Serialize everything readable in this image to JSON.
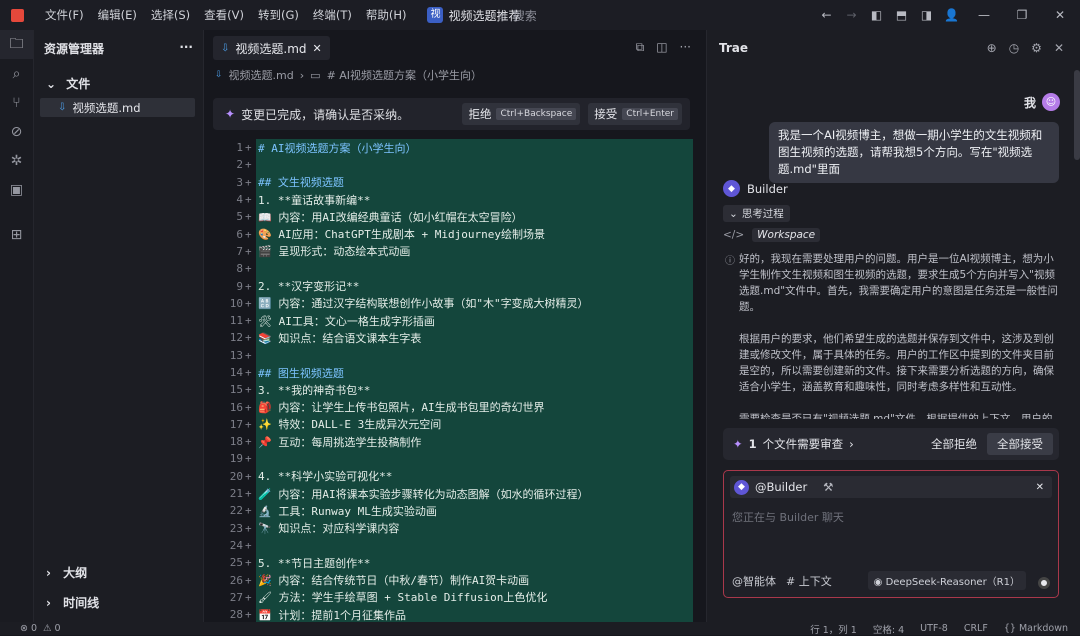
{
  "menu": [
    "文件(F)",
    "编辑(E)",
    "选择(S)",
    "查看(V)",
    "转到(G)",
    "终端(T)",
    "帮助(H)"
  ],
  "project": {
    "badge": "视",
    "name": "视频选题推荐"
  },
  "search": {
    "placeholder": "搜索"
  },
  "explorer": {
    "title": "资源管理器",
    "section": "文件",
    "file": "视频选题.md",
    "outline": "大纲",
    "timeline": "时间线"
  },
  "editor": {
    "tab_label": "视频选题.md",
    "breadcrumb_file": "视频选题.md",
    "breadcrumb_symbol": "# AI视频选题方案（小学生向）",
    "banner": {
      "text": "变更已完成，请确认是否采纳。",
      "reject_label": "拒绝",
      "reject_key": "Ctrl+Backspace",
      "accept_label": "接受",
      "accept_key": "Ctrl+Enter"
    },
    "lines": [
      {
        "n": "1",
        "t": "# AI视频选题方案（小学生向）",
        "h": true
      },
      {
        "n": "2",
        "t": ""
      },
      {
        "n": "3",
        "t": "## 文生视频选题",
        "h": true
      },
      {
        "n": "4",
        "t": "1. **童话故事新编**"
      },
      {
        "n": "5",
        "t": "   📖 内容：用AI改编经典童话（如小红帽在太空冒险）"
      },
      {
        "n": "6",
        "t": "   🎨 AI应用：ChatGPT生成剧本 + Midjourney绘制场景"
      },
      {
        "n": "7",
        "t": "   🎬 呈现形式：动态绘本式动画"
      },
      {
        "n": "8",
        "t": ""
      },
      {
        "n": "9",
        "t": "2. **汉字变形记**"
      },
      {
        "n": "10",
        "t": "   🔠 内容：通过汉字结构联想创作小故事（如\"木\"字变成大树精灵）"
      },
      {
        "n": "11",
        "t": "   🛠 AI工具：文心一格生成字形插画"
      },
      {
        "n": "12",
        "t": "   📚 知识点：结合语文课本生字表"
      },
      {
        "n": "13",
        "t": ""
      },
      {
        "n": "14",
        "t": "## 图生视频选题",
        "h": true
      },
      {
        "n": "15",
        "t": "3. **我的神奇书包**"
      },
      {
        "n": "16",
        "t": "   🎒 内容：让学生上传书包照片，AI生成书包里的奇幻世界"
      },
      {
        "n": "17",
        "t": "   ✨ 特效：DALL-E 3生成异次元空间"
      },
      {
        "n": "18",
        "t": "   📌 互动：每周挑选学生投稿制作"
      },
      {
        "n": "19",
        "t": ""
      },
      {
        "n": "20",
        "t": "4. **科学小实验可视化**"
      },
      {
        "n": "21",
        "t": "   🧪 内容：用AI将课本实验步骤转化为动态图解（如水的循环过程）"
      },
      {
        "n": "22",
        "t": "   🔬 工具：Runway ML生成实验动画"
      },
      {
        "n": "23",
        "t": "   🔭 知识点：对应科学课内容"
      },
      {
        "n": "24",
        "t": ""
      },
      {
        "n": "25",
        "t": "5. **节日主题创作**"
      },
      {
        "n": "26",
        "t": "   🎉 内容：结合传统节日（中秋/春节）制作AI贺卡动画"
      },
      {
        "n": "27",
        "t": "   🖌 方法：学生手绘草图 + Stable Diffusion上色优化"
      },
      {
        "n": "28",
        "t": "   📅 计划：提前1个月征集作品"
      }
    ]
  },
  "trae": {
    "title": "Trae",
    "user_name": "我",
    "user_message": "我是一个AI视频博主，想做一期小学生的文生视频和图生视频的选题，请帮我想5个方向。写在\"视频选题.md\"里面",
    "agent_name": "Builder",
    "thinking_label": "思考过程",
    "workspace_label": "Workspace",
    "reasoning": [
      "好的，我现在需要处理用户的问题。用户是一位AI视频博主，想为小学生制作文生视频和图生视频的选题，要求生成5个方向并写入\"视频选题.md\"文件中。首先，我需要确定用户的意图是任务还是一般性问题。",
      "根据用户的要求，他们希望生成的选题并保存到文件中，这涉及到创建或修改文件，属于具体的任务。用户的工作区中提到的文件夹目前是空的，所以需要创建新的文件。接下来需要分析选题的方向，确保适合小学生，涵盖教育和趣味性，同时考虑多样性和互动性。",
      "需要检查是否已有\"视频选题.md\"文件。根据提供的上下文，用户的工作区文件夹是空的，因此需要创建该文件。然后生成五个合适的选题，涵盖不同"
    ],
    "review_count": "1",
    "review_text": "个文件需要审查",
    "reject_all": "全部拒绝",
    "accept_all": "全部接受",
    "chat_agent": "@Builder",
    "chat_placeholder": "您正在与 Builder 聊天",
    "chat_option_1": "@智能体",
    "chat_option_2": "# 上下文",
    "model": "DeepSeek-Reasoner（R1）"
  },
  "status": {
    "errors": "0",
    "warnings": "0",
    "position": "行 1，列 1",
    "indent": "空格: 4",
    "encoding": "UTF-8",
    "eol": "CRLF",
    "language": "Markdown"
  }
}
